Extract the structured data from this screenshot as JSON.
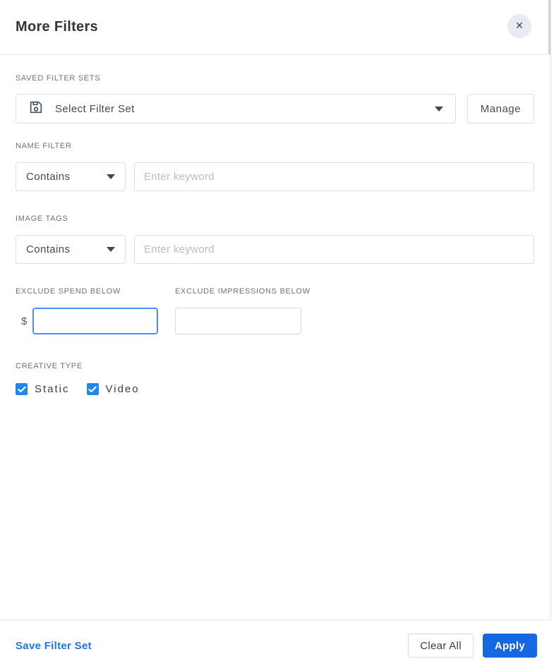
{
  "header": {
    "title": "More Filters",
    "close_glyph": "✕"
  },
  "saved_filter_sets": {
    "label": "SAVED FILTER SETS",
    "selected_value": "Select Filter Set",
    "manage_label": "Manage"
  },
  "name_filter": {
    "label": "NAME FILTER",
    "operator": "Contains",
    "value": "",
    "placeholder": "Enter keyword"
  },
  "image_tags": {
    "label": "IMAGE TAGS",
    "operator": "Contains",
    "value": "",
    "placeholder": "Enter keyword"
  },
  "exclude_spend": {
    "label": "EXCLUDE SPEND BELOW",
    "currency_symbol": "$",
    "value": ""
  },
  "exclude_impressions": {
    "label": "EXCLUDE IMPRESSIONS BELOW",
    "value": ""
  },
  "creative_type": {
    "label": "CREATIVE TYPE",
    "options": [
      {
        "label": "Static",
        "checked": true
      },
      {
        "label": "Video",
        "checked": true
      }
    ]
  },
  "footer": {
    "save_link_label": "Save Filter Set",
    "clear_label": "Clear All",
    "apply_label": "Apply"
  },
  "colors": {
    "accent_blue": "#1567e2",
    "checkbox_blue": "#1e88f0",
    "focus_border_blue": "#4a8ff7",
    "link_blue": "#2173e8",
    "label_gray": "#6d737c",
    "control_border": "#dcdee3",
    "close_circle_bg": "#e8ebf1"
  }
}
